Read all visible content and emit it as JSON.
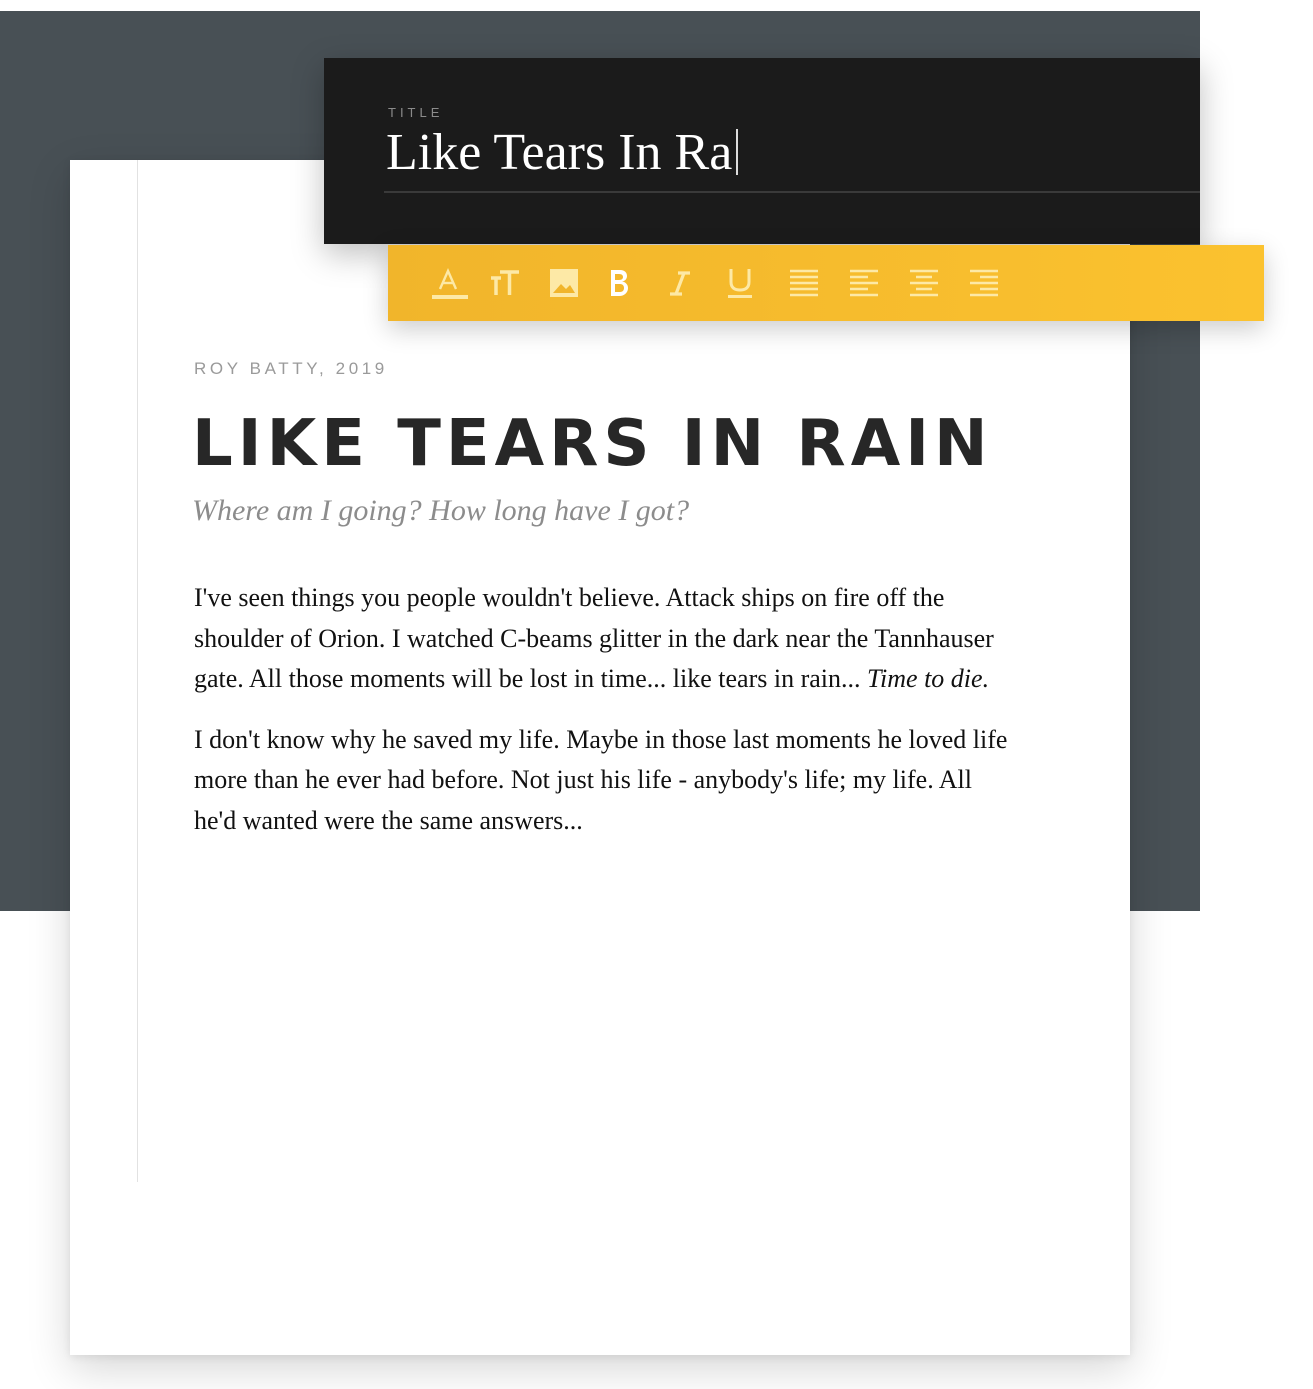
{
  "title_panel": {
    "label": "TITLE",
    "input_value": "Like Tears In Ra"
  },
  "toolbar": {
    "tools": [
      {
        "name": "text-color",
        "icon": "text-color-icon"
      },
      {
        "name": "text-size",
        "icon": "text-size-icon"
      },
      {
        "name": "image",
        "icon": "image-icon"
      },
      {
        "name": "bold",
        "icon": "bold-icon"
      },
      {
        "name": "italic",
        "icon": "italic-icon"
      },
      {
        "name": "underline",
        "icon": "underline-icon"
      },
      {
        "name": "align-justify",
        "icon": "align-justify-icon"
      },
      {
        "name": "align-left",
        "icon": "align-left-icon"
      },
      {
        "name": "align-center",
        "icon": "align-center-icon"
      },
      {
        "name": "align-right",
        "icon": "align-right-icon"
      }
    ]
  },
  "document": {
    "byline": "ROY BATTY, 2019",
    "headline": "LIKE TEARS IN RAIN",
    "subtitle": "Where am I going? How long have I got?",
    "paragraph_1": "I've seen things you people wouldn't believe. Attack ships on fire off the shoulder of Orion. I watched C-beams glitter in the dark near the Tannhauser gate. All those moments will be lost in time... like tears in rain...",
    "paragraph_1_emphasis": "Time to die.",
    "paragraph_2": "I don't know why he saved my life. Maybe in those last moments he loved life more than he ever had before. Not just his life - anybody's life; my life. All he'd wanted were the same answers..."
  },
  "colors": {
    "backdrop": "#485055",
    "title_panel": "#1b1b1b",
    "toolbar_accent": "#fbc22f",
    "headline": "#272727",
    "muted_text": "#9a9a9a"
  }
}
